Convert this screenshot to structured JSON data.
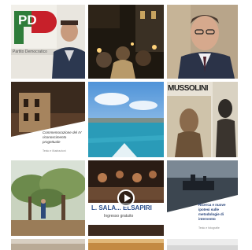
{
  "tiles": [
    {
      "name": "photo-pd-politician",
      "logo_text": "PD",
      "caption": "Partito Democratico"
    },
    {
      "name": "photo-night-vigil"
    },
    {
      "name": "photo-man-in-suit"
    },
    {
      "name": "photo-palace-article",
      "overlay_text": "Commemorazione del IV riconoscimento progettuale",
      "small_text": "Testo e illustrazioni"
    },
    {
      "name": "photo-sea-harbor"
    },
    {
      "name": "photo-mussolini-posters",
      "poster_text": "MUSSOLINI"
    },
    {
      "name": "photo-olive-trees"
    },
    {
      "name": "video-stage-event",
      "banner_text": "L. SALA... ELSAPIRI",
      "banner_sub": "Ingresso gratuito"
    },
    {
      "name": "photo-boat-article",
      "overlay_text": "Ricerca e nuove ipotesi sulle metodologie di intervento",
      "small_text": "Testo e fotografie"
    }
  ]
}
